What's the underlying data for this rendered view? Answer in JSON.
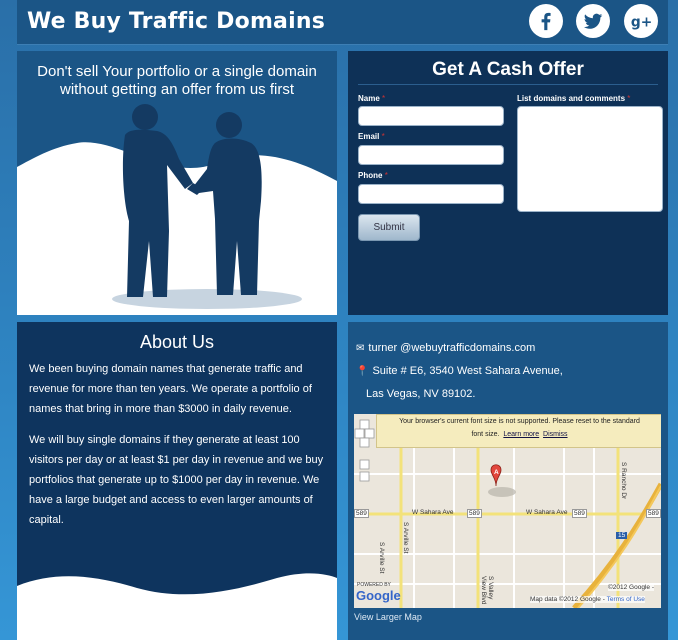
{
  "header": {
    "title": "We Buy Traffic Domains",
    "social": [
      {
        "name": "facebook-icon",
        "glyph": "f"
      },
      {
        "name": "twitter-icon",
        "glyph": "t"
      },
      {
        "name": "google-plus-icon",
        "glyph": "g+"
      }
    ]
  },
  "hero": {
    "line1": "Don't sell Your portfolio or a single domain",
    "line2": "without getting an offer from us first"
  },
  "offer": {
    "title": "Get A Cash Offer",
    "name_label": "Name",
    "email_label": "Email",
    "phone_label": "Phone",
    "domains_label": "List domains and comments",
    "required_mark": "*",
    "submit_label": "Submit"
  },
  "about": {
    "title": "About Us",
    "p1": "We been buying domain names that generate traffic and revenue for more than ten years. We operate a portfolio of names that bring in more than $3000 in daily revenue.",
    "p2": "We will buy single domains if they generate at least 100 visitors per day or at least $1 per day in revenue and we buy portfolios that generate up to $1000 per day in revenue. We have a large budget and access to even larger amounts of capital."
  },
  "contact": {
    "email": "turner @webuytrafficdomains.com",
    "address1": "Suite # E6, 3540 West Sahara Avenue,",
    "address2": "Las Vegas, NV 89102.",
    "view_map": "View Larger Map"
  },
  "map": {
    "notice1": "Your browser's current font size is not supported. Please reset to the standard",
    "notice2": "font size.",
    "learn_more": "Learn more",
    "dismiss": "Dismiss",
    "street_main": "W Sahara Ave",
    "street_main2": "W Sahara Ave",
    "route": "589",
    "street_a": "S Arville St",
    "street_b": "S Valley View Blvd",
    "street_c": "S Rancho Dr",
    "freeway": "15",
    "marker": "A",
    "powered": "POWERED BY",
    "google": "Google",
    "copyright": "©2012 Google -",
    "mapdata": "Map data ©2012 Google -",
    "terms": "Terms of Use",
    "accent": "#e8b23c"
  }
}
